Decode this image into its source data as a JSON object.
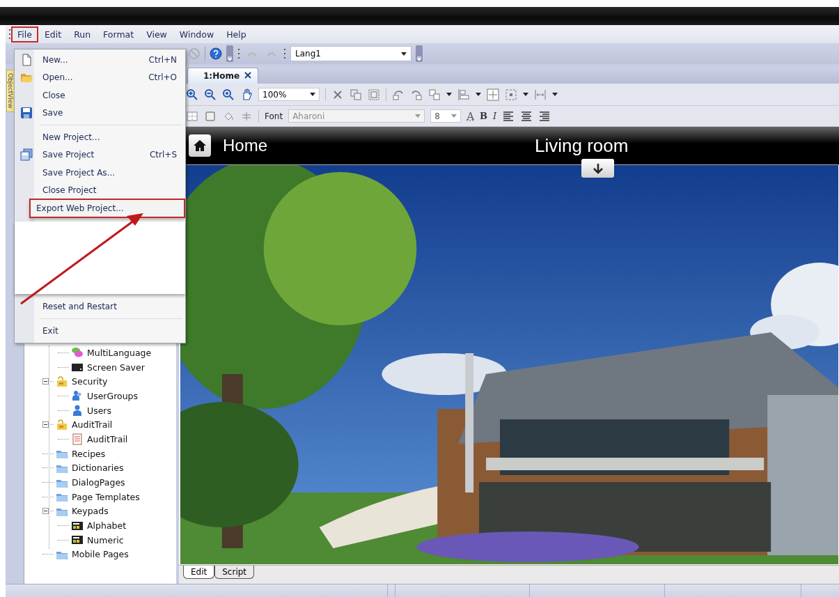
{
  "menu_bar": [
    {
      "label": "File",
      "selected": true
    },
    {
      "label": "Edit",
      "selected": false
    },
    {
      "label": "Run",
      "selected": false
    },
    {
      "label": "Format",
      "selected": false
    },
    {
      "label": "View",
      "selected": false
    },
    {
      "label": "Window",
      "selected": false
    },
    {
      "label": "Help",
      "selected": false
    }
  ],
  "toolbar": {
    "language": "Lang1"
  },
  "side_tab": {
    "label": "ObjectView"
  },
  "document_tabs": [
    {
      "label": "1:Home",
      "selected": true
    }
  ],
  "zoom_toolbar": {
    "zoom": "100%"
  },
  "format_toolbar": {
    "font_label": "Font",
    "font": {
      "value": "Aharoni",
      "disabled": true
    },
    "size": "8",
    "color_button": "A",
    "bold_button": "B",
    "italic_button": "I"
  },
  "hmi_page": {
    "home_label": "Home",
    "room_title": "Living room"
  },
  "bottom_tabs": [
    {
      "label": "Edit",
      "selected": true
    },
    {
      "label": "Script",
      "selected": false
    }
  ],
  "tree": [
    {
      "children": [
        {
          "label": "MultiLanguage",
          "kind": "chat"
        },
        {
          "label": "Screen Saver",
          "kind": "screen"
        }
      ]
    },
    {
      "label": "Security",
      "kind": "lock-folder",
      "expanded": true,
      "children": [
        {
          "label": "UserGroups",
          "kind": "user-group"
        },
        {
          "label": "Users",
          "kind": "user"
        }
      ]
    },
    {
      "label": "AuditTrail",
      "kind": "lock-folder",
      "expanded": true,
      "children": [
        {
          "label": "AuditTrail",
          "kind": "checklist"
        }
      ]
    },
    {
      "label": "Recipes",
      "kind": "folder"
    },
    {
      "label": "Dictionaries",
      "kind": "folder"
    },
    {
      "label": "DialogPages",
      "kind": "folder"
    },
    {
      "label": "Page Templates",
      "kind": "folder"
    },
    {
      "label": "Keypads",
      "kind": "folder",
      "expanded": true,
      "children": [
        {
          "label": "Alphabet",
          "kind": "keypad"
        },
        {
          "label": "Numeric",
          "kind": "keypad"
        }
      ]
    },
    {
      "label": "Mobile Pages",
      "kind": "folder"
    }
  ],
  "file_menu": [
    {
      "kind": "file-item",
      "label": "New...",
      "shortcut": "Ctrl+N"
    },
    {
      "kind": "folder-item",
      "label": "Open...",
      "shortcut": "Ctrl+O"
    },
    {
      "kind": "item",
      "label": "Close"
    },
    {
      "kind": "disk-item",
      "label": "Save"
    },
    {
      "kind": "separator"
    },
    {
      "kind": "item",
      "label": "New Project..."
    },
    {
      "kind": "disks-item",
      "label": "Save Project",
      "shortcut": "Ctrl+S"
    },
    {
      "kind": "item",
      "label": "Save Project As..."
    },
    {
      "kind": "item",
      "label": "Close Project"
    },
    {
      "kind": "item",
      "label": "Export Web Project...",
      "highlighted": true
    },
    {
      "kind": "blank"
    },
    {
      "kind": "item",
      "label": "Reset and Restart"
    },
    {
      "kind": "separator"
    },
    {
      "kind": "item",
      "label": "Exit"
    }
  ]
}
